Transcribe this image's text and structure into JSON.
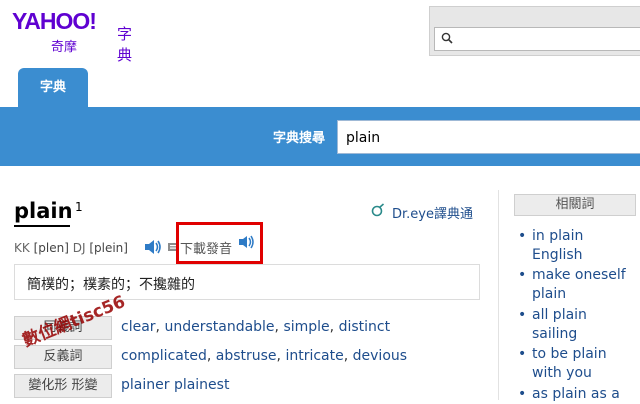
{
  "header": {
    "brand": "YAHOO!",
    "brand_sub": "奇摩",
    "dict_label": "字典"
  },
  "tabs": [
    {
      "label": "字典",
      "active": true
    }
  ],
  "searchbar": {
    "label": "字典搜尋",
    "value": "plain"
  },
  "entry": {
    "word": "plain",
    "sup": "1",
    "dreye": "Dr.eye譯典通",
    "pron_kk_label": "KK",
    "pron_kk": "[plen]",
    "pron_dj_label": "DJ",
    "pron_dj": "[plein]",
    "download_label": "下載發音",
    "definition": "簡樸的；樸素的；不攙雜的",
    "rows": [
      {
        "tag": "同義詞",
        "values": [
          "clear",
          "understandable",
          "simple",
          "distinct"
        ]
      },
      {
        "tag": "反義詞",
        "values": [
          "complicated",
          "abstruse",
          "intricate",
          "devious"
        ]
      },
      {
        "tag": "變化形 形變",
        "values": [
          "plainer plainest"
        ]
      }
    ]
  },
  "watermark": "數位網tisc56",
  "related": {
    "title": "相關詞",
    "items": [
      "in plain English",
      "make oneself plain",
      "all plain sailing",
      "to be plain with you",
      "as plain as a"
    ]
  },
  "colors": {
    "brand": "#5f01d1",
    "bar": "#3b8dd0",
    "link": "#1e4d8c",
    "highlight": "#e00000"
  }
}
